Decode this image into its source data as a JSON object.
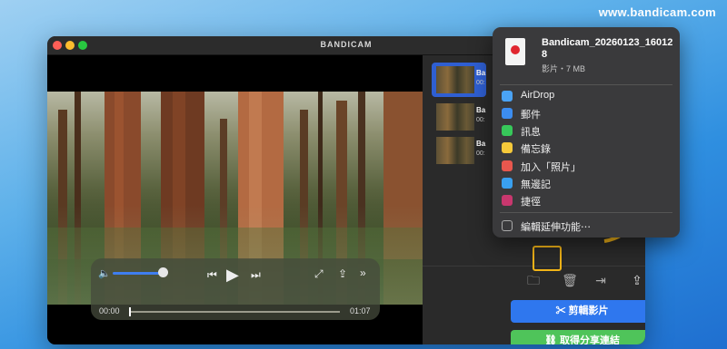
{
  "watermark": "www.bandicam.com",
  "window": {
    "title": "BANDICAM"
  },
  "player": {
    "current_time": "00:00",
    "duration": "01:07",
    "volume_level": 0.85,
    "playback_progress": 0.0
  },
  "recordings": [
    {
      "label": "Ba",
      "sub": "00:"
    },
    {
      "label": "Ba",
      "sub": "00:"
    },
    {
      "label": "Ba",
      "sub": "00:"
    }
  ],
  "buttons": {
    "edit": "剪輯影片",
    "link": "取得分享連結"
  },
  "share_menu": {
    "file_name": "Bandicam_20260123_160128",
    "file_meta": "影片・7 MB",
    "items": [
      {
        "label": "AirDrop",
        "icon": "airdrop-icon",
        "color": "#4aa3f5"
      },
      {
        "label": "郵件",
        "icon": "mail-icon",
        "color": "#3c8df0"
      },
      {
        "label": "訊息",
        "icon": "messages-icon",
        "color": "#37c85a"
      },
      {
        "label": "備忘錄",
        "icon": "notes-icon",
        "color": "#f5c93a"
      },
      {
        "label": "加入「照片」",
        "icon": "photos-icon",
        "color": "#e8574e"
      },
      {
        "label": "無邊記",
        "icon": "freeform-icon",
        "color": "#39a0f0"
      },
      {
        "label": "捷徑",
        "icon": "shortcuts-icon",
        "color": "#c8376e"
      }
    ],
    "edit_extensions": "編輯延伸功能⋯"
  },
  "colors": {
    "accent_blue": "#2f77ee",
    "accent_green": "#4fc45a",
    "highlight": "#f2b418"
  }
}
